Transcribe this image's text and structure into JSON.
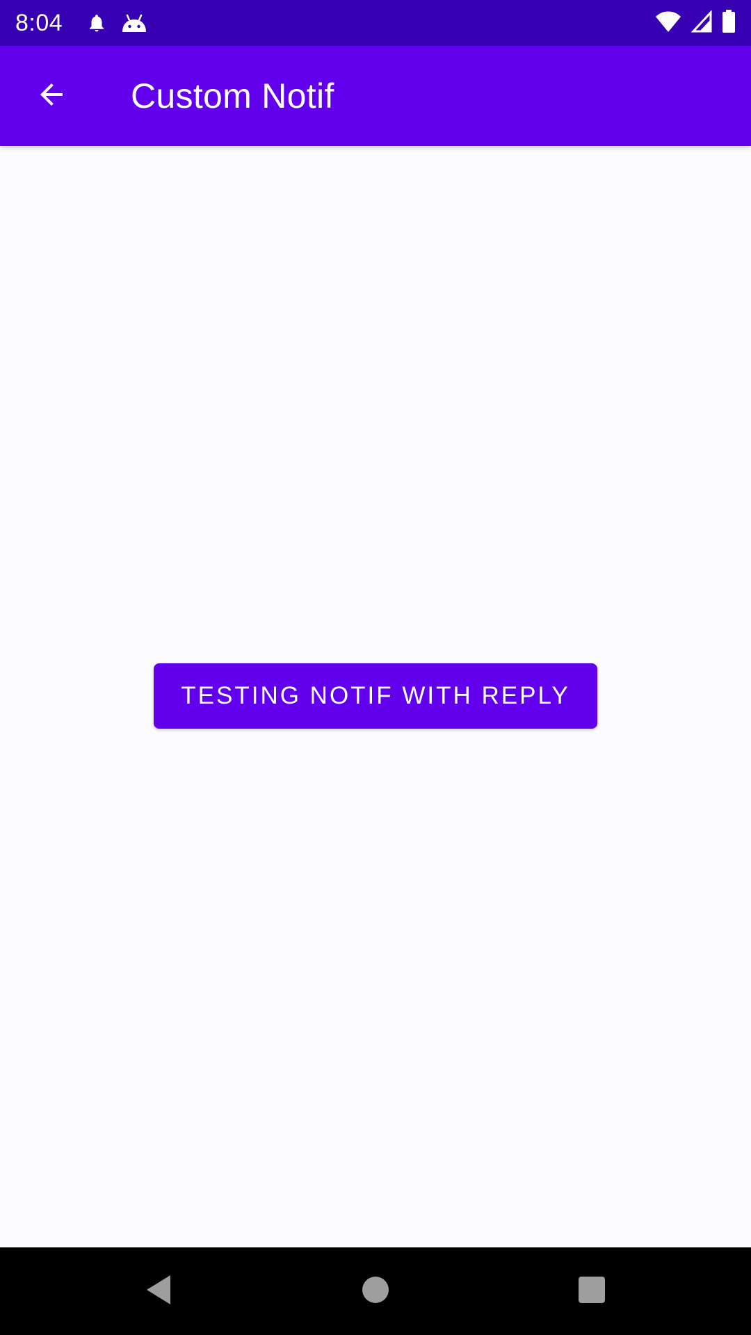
{
  "status_bar": {
    "time": "8:04",
    "left_icons": [
      "notification-bell-icon",
      "android-icon"
    ],
    "right_icons": [
      "wifi-icon",
      "signal-icon",
      "battery-icon"
    ],
    "background": "#3700b3"
  },
  "app_bar": {
    "title": "Custom Notif",
    "back_icon": "arrow-back-icon",
    "background": "#6200ee"
  },
  "main": {
    "button_label": "TESTING NOTIF WITH REPLY",
    "button_color": "#6200ee"
  },
  "nav_bar": {
    "buttons": [
      "back-triangle-icon",
      "home-circle-icon",
      "recents-square-icon"
    ],
    "background": "#000000"
  }
}
